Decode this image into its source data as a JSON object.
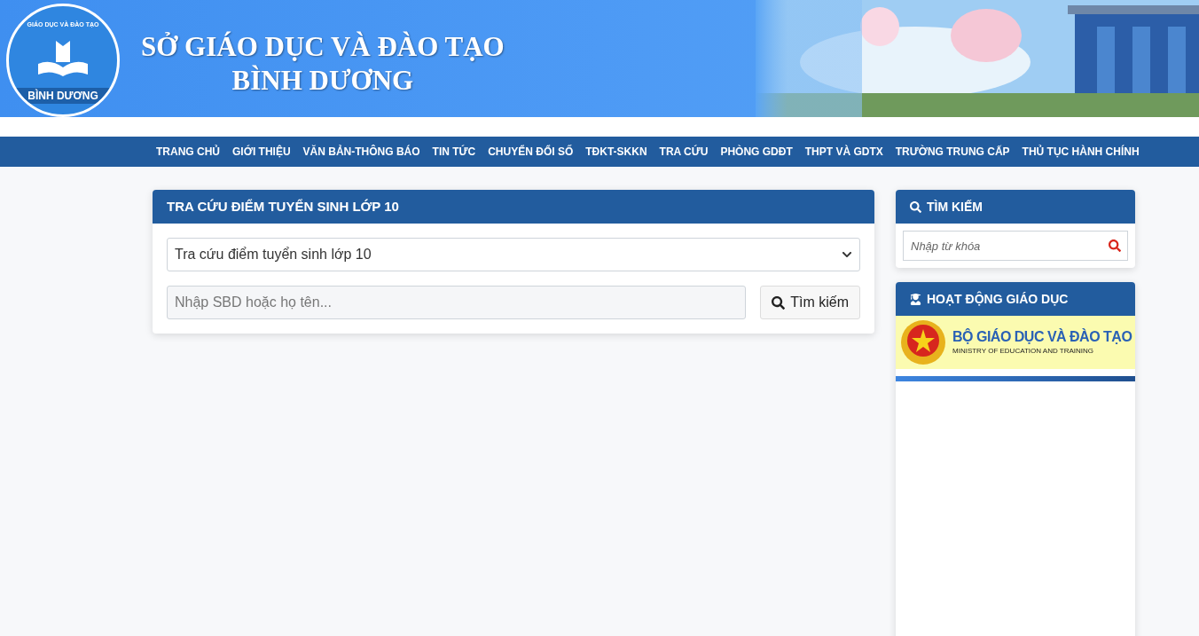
{
  "header": {
    "logo": {
      "top_text": "GIÁO DỤC VÀ ĐÀO TẠO",
      "bottom_text": "BÌNH DƯƠNG"
    },
    "title_line_1": "SỞ GIÁO DỤC VÀ ĐÀO TẠO",
    "title_line_2": "BÌNH DƯƠNG"
  },
  "nav": [
    "TRANG CHỦ",
    "GIỚI THIỆU",
    "VĂN BẢN-THÔNG BÁO",
    "TIN TỨC",
    "CHUYỂN ĐỔI SỐ",
    "TĐKT-SKKN",
    "TRA CỨU",
    "PHÒNG GDĐT",
    "THPT VÀ GDTX",
    "TRƯỜNG TRUNG CẤP",
    "THỦ TỤC HÀNH CHÍNH"
  ],
  "lookup": {
    "title": "TRA CỨU ĐIỂM TUYỂN SINH LỚP 10",
    "select_value": "Tra cứu điểm tuyển sinh lớp 10",
    "input_placeholder": "Nhập SBD hoặc họ tên...",
    "button": "Tìm kiếm"
  },
  "sidebar": {
    "search": {
      "title": "TÌM KIẾM",
      "placeholder": "Nhập từ khóa"
    },
    "activities": {
      "title": "HOẠT ĐỘNG GIÁO DỤC",
      "banner": {
        "title": "BỘ GIÁO DỤC VÀ ĐÀO TẠO",
        "subtitle": "MINISTRY OF EDUCATION AND TRAINING"
      }
    }
  }
}
